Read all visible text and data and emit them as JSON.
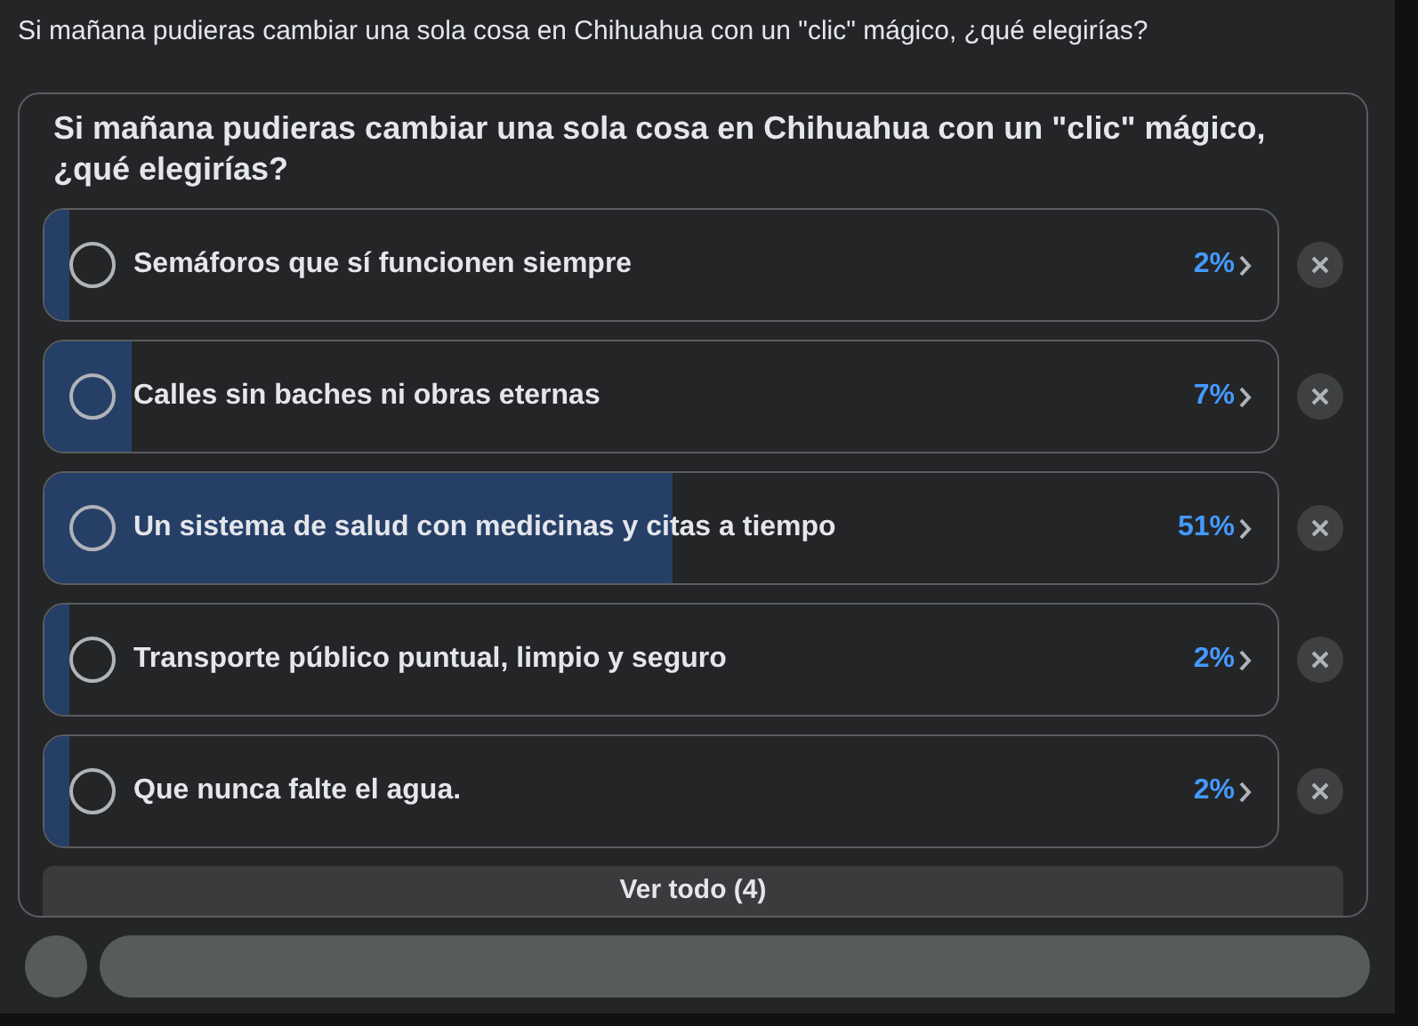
{
  "post": {
    "text": "Si mañana pudieras cambiar una sola cosa en Chihuahua con un \"clic\" mágico, ¿qué elegirías?"
  },
  "poll": {
    "question": "Si mañana pudieras cambiar una sola cosa en Chihuahua con un \"clic\" mágico, ¿qué elegirías?",
    "options": [
      {
        "label": "Semáforos que sí funcionen siempre",
        "percent": "2%",
        "level": 0.02,
        "selected": false
      },
      {
        "label": "Calles sin baches ni obras eternas",
        "percent": "7%",
        "level": 0.07,
        "selected": false
      },
      {
        "label": "Un sistema de salud con medicinas y citas a tiempo",
        "percent": "51%",
        "level": 0.51,
        "selected": false
      },
      {
        "label": "Transporte público puntual, limpio y seguro",
        "percent": "2%",
        "level": 0.02,
        "selected": false
      },
      {
        "label": "Que nunca falte el agua.",
        "percent": "2%",
        "level": 0.02,
        "selected": false
      }
    ],
    "see_all": "Ver todo (4)"
  }
}
